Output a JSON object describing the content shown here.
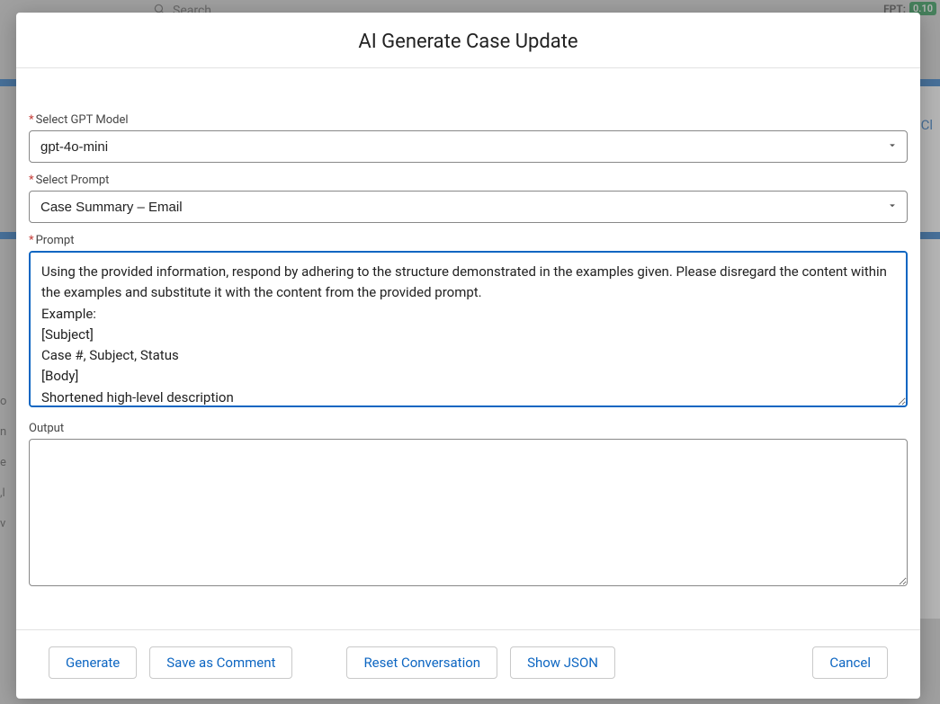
{
  "backdrop": {
    "search_placeholder": "Search",
    "fpt_label": "FPT:",
    "fpt_value": "0.10",
    "partial_link": "Cl",
    "left_letters": "o\nn\ne\n,l\nv"
  },
  "modal": {
    "title": "AI Generate Case Update",
    "fields": {
      "model": {
        "label": "Select GPT Model",
        "value": "gpt-4o-mini"
      },
      "prompt_select": {
        "label": "Select Prompt",
        "value": "Case Summary – Email"
      },
      "prompt": {
        "label": "Prompt",
        "value": "Using the provided information, respond by adhering to the structure demonstrated in the examples given. Please disregard the content within the examples and substitute it with the content from the provided prompt.\nExample:\n[Subject]\nCase #, Subject, Status\n[Body]\nShortened high-level description"
      },
      "output": {
        "label": "Output",
        "value": ""
      }
    },
    "buttons": {
      "generate": "Generate",
      "save_comment": "Save as Comment",
      "reset": "Reset Conversation",
      "show_json": "Show JSON",
      "cancel": "Cancel"
    }
  }
}
